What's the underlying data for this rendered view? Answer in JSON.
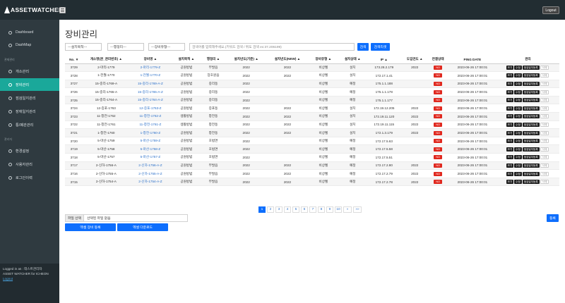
{
  "app": {
    "name": "ASSETWATCHER",
    "logout_label": "Logout"
  },
  "sidebar": {
    "items": [
      {
        "label": "Dashboard",
        "active": false
      },
      {
        "label": "DashMap",
        "active": false
      },
      {
        "label": "개소관리",
        "active": false
      },
      {
        "label": "장비관리",
        "active": true
      },
      {
        "label": "점검일지관리",
        "active": false
      },
      {
        "label": "장애일지관리",
        "active": false
      },
      {
        "label": "통/폐관관리",
        "active": false
      },
      {
        "label": "환경설정",
        "active": false
      },
      {
        "label": "사용자관리",
        "active": false
      },
      {
        "label": "로그인이력",
        "active": false
      }
    ],
    "section1": "관제관리",
    "section2": "관리자",
    "footer": {
      "logged_in_as": "Logged in as : 테스트관리자",
      "product": "ASSET WATCHER for ICHEON",
      "logout_link": "Logout"
    }
  },
  "page": {
    "title": "장비관리"
  },
  "filters": {
    "category": "---설치목적---",
    "district": "---행정리---",
    "type": "---장비유형---",
    "search_placeholder": "검색어를 입력해주세요.(키워드 검색 / 위도 검색 ex:37.206199)",
    "search_label": "검색",
    "reset_label": "검색리셋"
  },
  "table": {
    "columns": [
      "No. ▼",
      "개소명(관_관리번호) ▲",
      "장비명 ▲",
      "설치목적 ▲",
      "행정리 ▲",
      "설치년도(기준) ▲",
      "설치년도(NEW) ▲",
      "장비유형 ▲",
      "설치상태 ▲",
      "IP ▲",
      "도입연도 ▲",
      "연결상태",
      "PING DATE",
      "관리"
    ],
    "rows": [
      {
        "no": "3729",
        "site": "2-마리-1779",
        "device": "2-마리-1779-Z",
        "purpose": "공원방범",
        "district": "부발읍",
        "year_std": "2022",
        "year_new": "2022",
        "type": "비상벨",
        "state": "설치",
        "ip": "173.28.2.179",
        "intro": "2022",
        "conn": "NO",
        "ping": "2023-06-26 17:00:01"
      },
      {
        "no": "3728",
        "site": "1-전월-1770",
        "device": "1-전월-1770-Z",
        "purpose": "공원방범",
        "district": "장호원읍",
        "year_std": "2022",
        "year_new": "2022",
        "type": "비상벨",
        "state": "설치",
        "ip": "172.17.1.41",
        "intro": "",
        "conn": "NO",
        "ping": "2023-06-26 17:00:01"
      },
      {
        "no": "3727",
        "site": "15-중리-1769-A",
        "device": "15-중리-1769-A-Z",
        "purpose": "공원방범",
        "district": "중리동",
        "year_std": "2022",
        "year_new": "",
        "type": "비상벨",
        "state": "예정",
        "ip": "175.1.1.188",
        "intro": "",
        "conn": "NO",
        "ping": "2023-06-26 17:00:01"
      },
      {
        "no": "3726",
        "site": "15-중리-1765-A",
        "device": "15-중리-1765-A-Z",
        "purpose": "공원방범",
        "district": "중리동",
        "year_std": "2022",
        "year_new": "",
        "type": "비상벨",
        "state": "예정",
        "ip": "175.1.1.178",
        "intro": "",
        "conn": "NO",
        "ping": "2023-06-26 17:00:01"
      },
      {
        "no": "3725",
        "site": "15-중리-1764-A",
        "device": "15-중리-1764-A-Z",
        "purpose": "공원방범",
        "district": "중리동",
        "year_std": "2022",
        "year_new": "",
        "type": "비상벨",
        "state": "예정",
        "ip": "175.1.1.177",
        "intro": "",
        "conn": "NO",
        "ping": "2023-06-26 17:00:01"
      },
      {
        "no": "3724",
        "site": "12-증포-1763",
        "device": "12-증포-1763-Z",
        "purpose": "공원방범",
        "district": "증포동",
        "year_std": "2022",
        "year_new": "2022",
        "type": "비상벨",
        "state": "설치",
        "ip": "172.19.12.205",
        "intro": "2022",
        "conn": "NO",
        "ping": "2023-06-26 17:00:01"
      },
      {
        "no": "3723",
        "site": "11-창전-1762",
        "device": "11-창전-1762-Z",
        "purpose": "생활방범",
        "district": "창전동",
        "year_std": "2022",
        "year_new": "2022",
        "type": "비상벨",
        "state": "설치",
        "ip": "172.19.11.120",
        "intro": "2022",
        "conn": "NO",
        "ping": "2023-06-26 17:00:01"
      },
      {
        "no": "3722",
        "site": "11-창전-1761",
        "device": "11-창전-1761-Z",
        "purpose": "생활방범",
        "district": "창전동",
        "year_std": "2022",
        "year_new": "2022",
        "type": "비상벨",
        "state": "설치",
        "ip": "172.19.11.115",
        "intro": "2022",
        "conn": "NO",
        "ping": "2023-06-26 17:00:01"
      },
      {
        "no": "3721",
        "site": "1-창전-1760",
        "device": "1-창전-1760-Z",
        "purpose": "공원방범",
        "district": "창전동",
        "year_std": "2022",
        "year_new": "2022",
        "type": "비상벨",
        "state": "설치",
        "ip": "172.1.3.179",
        "intro": "2022",
        "conn": "NO",
        "ping": "2023-06-26 17:00:01"
      },
      {
        "no": "3720",
        "site": "5-마산-1759",
        "device": "5-마산-1759-Z",
        "purpose": "공원방범",
        "district": "호법면",
        "year_std": "2022",
        "year_new": "",
        "type": "비상벨",
        "state": "예정",
        "ip": "172.17.5.63",
        "intro": "",
        "conn": "NO",
        "ping": "2023-06-26 17:00:01"
      },
      {
        "no": "3719",
        "site": "5-마산-1758",
        "device": "5-마산-1758-Z",
        "purpose": "공원방범",
        "district": "호법면",
        "year_std": "2022",
        "year_new": "",
        "type": "비상벨",
        "state": "예정",
        "ip": "172.17.5.58",
        "intro": "",
        "conn": "NO",
        "ping": "2023-06-26 17:00:01"
      },
      {
        "no": "3718",
        "site": "5-마산-1757",
        "device": "5-마산-1757-Z",
        "purpose": "공원방범",
        "district": "호법면",
        "year_std": "2022",
        "year_new": "",
        "type": "비상벨",
        "state": "예정",
        "ip": "172.17.5.51",
        "intro": "",
        "conn": "NO",
        "ping": "2023-06-26 17:00:01"
      },
      {
        "no": "3717",
        "site": "2-신하-1756-A",
        "device": "2-신하-1756-A-Z",
        "purpose": "공원방범",
        "district": "부발읍",
        "year_std": "2022",
        "year_new": "2022",
        "type": "비상벨",
        "state": "예정",
        "ip": "172.17.2.80",
        "intro": "2022",
        "conn": "NO",
        "ping": "2023-06-26 17:00:01"
      },
      {
        "no": "3716",
        "site": "2-신하-1755-A",
        "device": "2-신하-1755-A-Z",
        "purpose": "공원방범",
        "district": "부발읍",
        "year_std": "2022",
        "year_new": "2022",
        "type": "비상벨",
        "state": "예정",
        "ip": "172.17.2.79",
        "intro": "2022",
        "conn": "NO",
        "ping": "2023-06-26 17:00:01"
      },
      {
        "no": "3715",
        "site": "2-신하-1754-A",
        "device": "2-신하-1754-A-Z",
        "purpose": "공원방범",
        "district": "부발읍",
        "year_std": "2022",
        "year_new": "2022",
        "type": "비상벨",
        "state": "예정",
        "ip": "172.17.2.78",
        "intro": "2022",
        "conn": "NO",
        "ping": "2023-06-26 17:00:01"
      }
    ],
    "actions": {
      "view": "보기",
      "edit": "수정",
      "inspect": "점검일지등록",
      "delete": "삭제"
    }
  },
  "pagination": {
    "pages": [
      "1",
      "2",
      "3",
      "4",
      "5",
      "6",
      "7",
      "8",
      "9",
      "10"
    ],
    "current": "1",
    "next": "»",
    "last": "»»"
  },
  "bottom": {
    "file_choose": "파일 선택",
    "file_none": "선택된 파일 없음",
    "excel_register": "엑셀 장비 등록",
    "excel_download": "엑셀 다운로드",
    "register": "등록"
  },
  "colors": {
    "accent": "#1aa89a",
    "primary": "#0d6efd",
    "danger": "#e0281e",
    "topbar": "#222d32",
    "sidebar": "#2f3a40"
  }
}
